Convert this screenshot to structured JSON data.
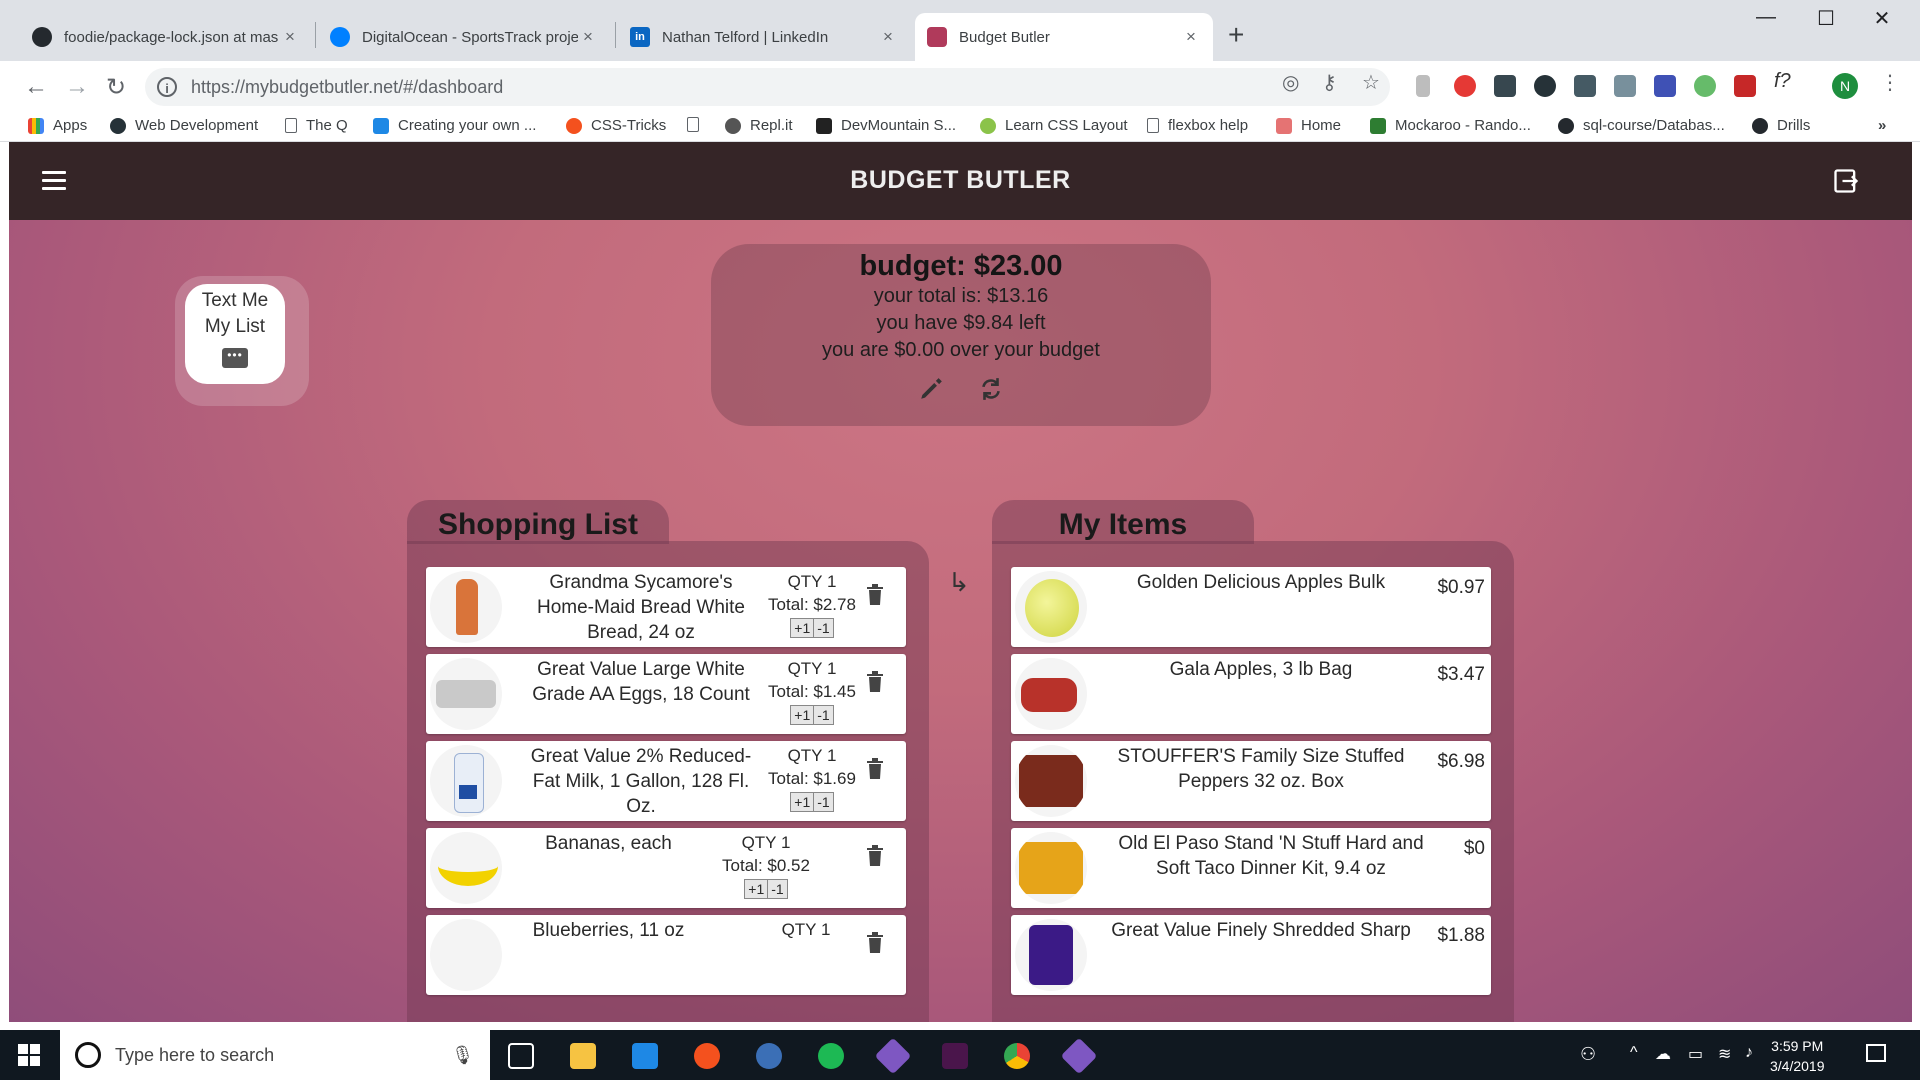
{
  "browser": {
    "tabs": [
      {
        "title": "foodie/package-lock.json at mas",
        "close": "×"
      },
      {
        "title": "DigitalOcean - SportsTrack proje",
        "close": "×"
      },
      {
        "title": "Nathan Telford | LinkedIn",
        "close": "×"
      },
      {
        "title": "Budget Butler",
        "close": "×"
      }
    ],
    "new_tab": "+",
    "window_controls": {
      "minimize": "—",
      "maximize": "☐",
      "close": "✕"
    },
    "url": "https://mybudgetbutler.net/#/dashboard",
    "profile_initial": "N",
    "bookmarks": [
      "Apps",
      "Web Development",
      "The Q",
      "Creating your own ...",
      "CSS-Tricks",
      "",
      "Repl.it",
      "DevMountain S...",
      "Learn CSS Layout",
      "flexbox help",
      "Home",
      "Mockaroo - Rando...",
      "sql-course/Databas...",
      "Drills"
    ],
    "bookmarks_more": "»"
  },
  "app": {
    "title": "BUDGET BUTLER",
    "text_me": {
      "line1": "Text Me",
      "line2": "My List",
      "chat_dots": "•••"
    },
    "budget": {
      "title": "budget: $23.00",
      "total": "your total is: $13.16",
      "left": "you have $9.84 left",
      "over": "you are $0.00 over your budget"
    },
    "shopping_list": {
      "heading": "Shopping List",
      "items": [
        {
          "name": "Grandma Sycamore's Home-Maid Bread White Bread, 24 oz",
          "qty": "QTY 1",
          "total": "Total: $2.78",
          "plus": "+1",
          "minus": "-1"
        },
        {
          "name": "Great Value Large White Grade AA Eggs, 18 Count",
          "qty": "QTY 1",
          "total": "Total: $1.45",
          "plus": "+1",
          "minus": "-1"
        },
        {
          "name": "Great Value 2% Reduced-Fat Milk, 1 Gallon, 128 Fl. Oz.",
          "qty": "QTY 1",
          "total": "Total: $1.69",
          "plus": "+1",
          "minus": "-1"
        },
        {
          "name": "Bananas, each",
          "qty": "QTY 1",
          "total": "Total: $0.52",
          "plus": "+1",
          "minus": "-1"
        },
        {
          "name": "Blueberries, 11 oz",
          "qty": "QTY 1",
          "total": "",
          "plus": "",
          "minus": ""
        }
      ]
    },
    "arrow": "↳",
    "my_items": {
      "heading": "My Items",
      "items": [
        {
          "name": "Golden Delicious Apples Bulk",
          "price": "$0.97"
        },
        {
          "name": "Gala Apples, 3 lb Bag",
          "price": "$3.47"
        },
        {
          "name": "STOUFFER'S Family Size Stuffed Peppers 32 oz. Box",
          "price": "$6.98"
        },
        {
          "name": "Old El Paso Stand 'N Stuff Hard and Soft Taco Dinner Kit, 9.4 oz",
          "price": "$0"
        },
        {
          "name": "Great Value Finely Shredded Sharp",
          "price": "$1.88"
        }
      ]
    }
  },
  "taskbar": {
    "search_placeholder": "Type here to search",
    "time": "3:59 PM",
    "date": "3/4/2019"
  },
  "colors": {
    "header_bg": "#352527",
    "app_bg": "#c26b7c"
  }
}
